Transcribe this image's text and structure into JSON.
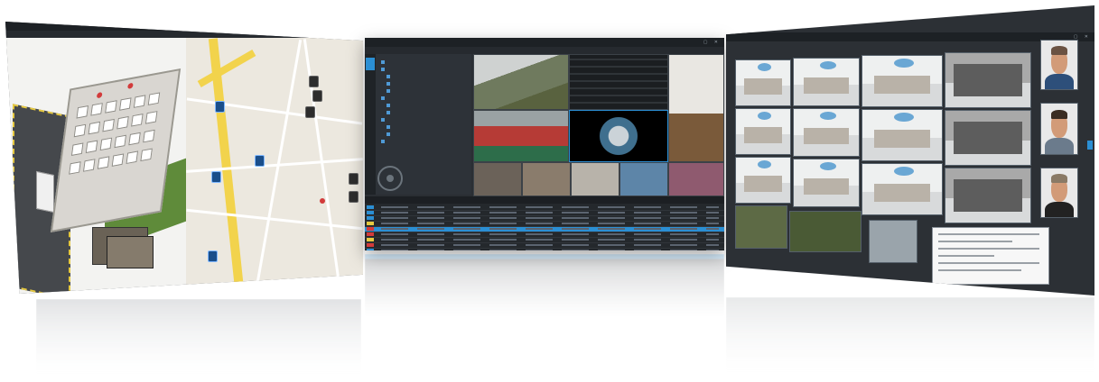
{
  "left_window": {
    "title": "",
    "menu": [
      "",
      "",
      "",
      ""
    ],
    "map_pins": 9
  },
  "center_window": {
    "title": "",
    "tree_items": [
      "",
      "",
      "",
      "",
      "",
      "",
      "",
      "",
      "",
      "",
      "",
      ""
    ],
    "event_rows": 9,
    "highlighted_row": 4
  },
  "right_window": {
    "title": "",
    "camera_rows": 3,
    "face_matches": 3
  },
  "colors": {
    "accent_blue": "#2b8fd4",
    "alert_red": "#d23b3b",
    "alert_yellow": "#e6c940",
    "panel_dark": "#2b2f34",
    "map_bg": "#ece8df",
    "road_major": "#f2d34c"
  },
  "icons": [
    "map-pin-icon",
    "camera-icon",
    "ptz-joystick-icon",
    "close-icon"
  ]
}
